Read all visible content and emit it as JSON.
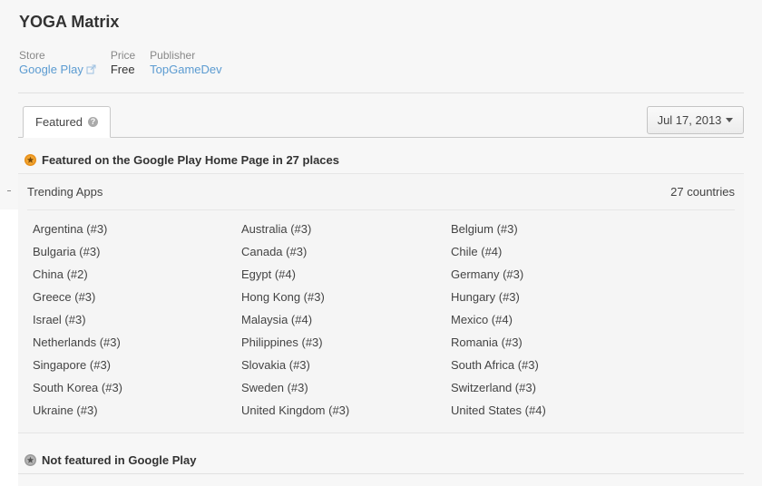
{
  "app": {
    "title": "YOGA Matrix"
  },
  "meta": {
    "store_label": "Store",
    "store_value": "Google Play",
    "price_label": "Price",
    "price_value": "Free",
    "publisher_label": "Publisher",
    "publisher_value": "TopGameDev"
  },
  "tabs": [
    {
      "label": "Featured"
    }
  ],
  "date_selector": {
    "value": "Jul 17, 2013"
  },
  "featured": {
    "heading_prefix": "Featured on the Google Play Home Page",
    "heading_in": " in ",
    "heading_count": "27 places"
  },
  "trending": {
    "title": "Trending Apps",
    "count": "27 countries",
    "countries": [
      "Argentina (#3)",
      "Australia (#3)",
      "Belgium (#3)",
      "Bulgaria (#3)",
      "Canada (#3)",
      "Chile (#4)",
      "China (#2)",
      "Egypt (#4)",
      "Germany (#3)",
      "Greece (#3)",
      "Hong Kong (#3)",
      "Hungary (#3)",
      "Israel (#3)",
      "Malaysia (#4)",
      "Mexico (#4)",
      "Netherlands (#3)",
      "Philippines (#3)",
      "Romania (#3)",
      "Singapore (#3)",
      "Slovakia (#3)",
      "South Africa (#3)",
      "South Korea (#3)",
      "Sweden (#3)",
      "Switzerland (#3)",
      "Ukraine (#3)",
      "United Kingdom (#3)",
      "United States (#4)"
    ]
  },
  "not_featured": {
    "heading": "Not featured in Google Play"
  },
  "icons": {
    "external": "external-link-icon",
    "help": "question-circle-icon",
    "featured": "star-badge-icon",
    "not_featured": "star-badge-grey-icon",
    "dropdown": "caret-down-icon"
  },
  "colors": {
    "link": "#5b9bd1",
    "featured_badge": "#e8901a",
    "not_featured_badge": "#9a9a9a"
  }
}
